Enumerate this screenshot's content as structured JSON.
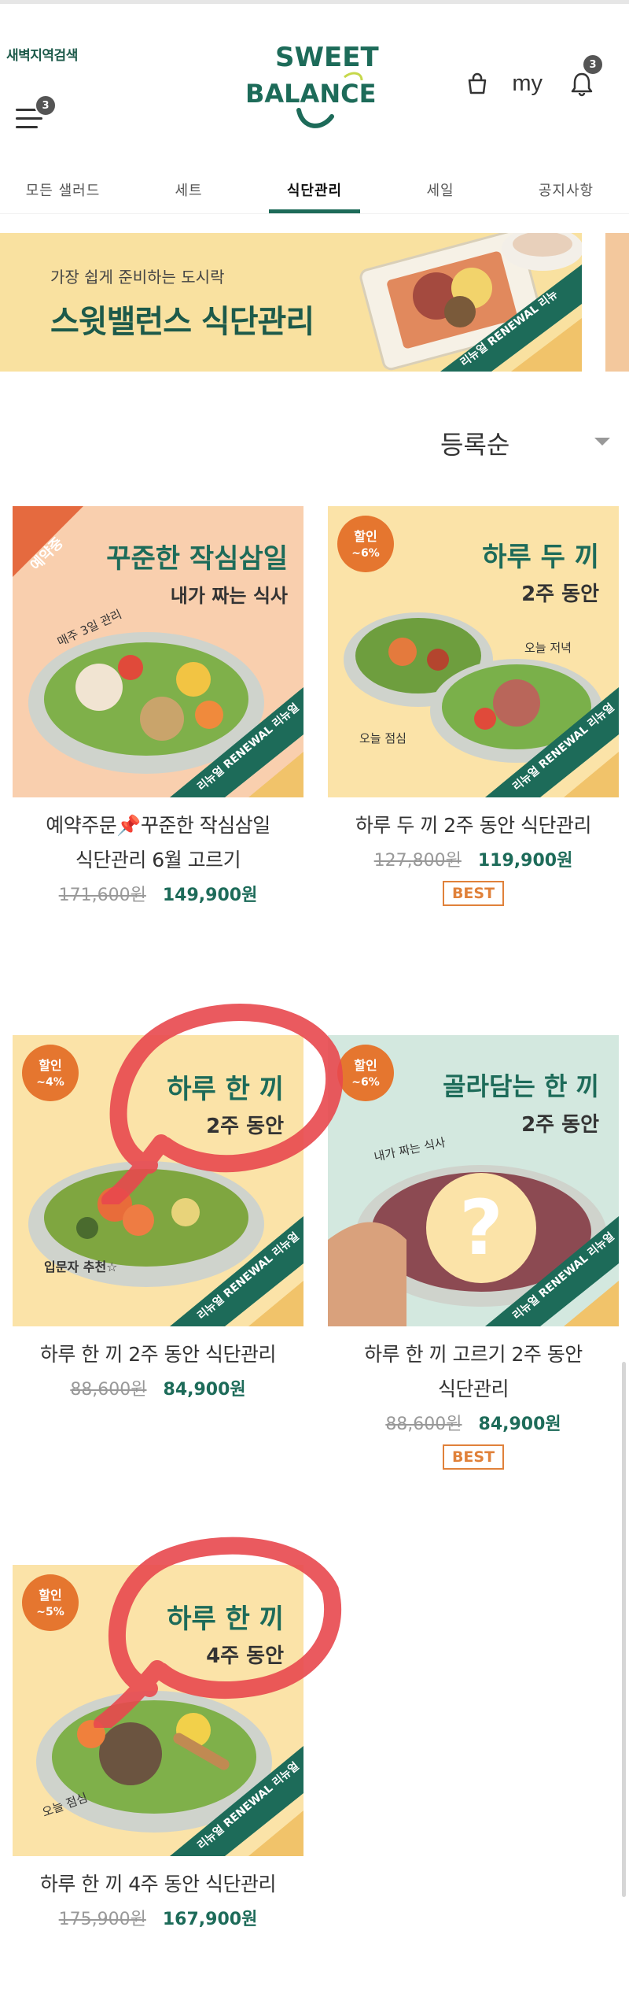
{
  "header": {
    "region_search": "새벽지역검색",
    "menu_badge": "3",
    "logo_top": "SWEET",
    "logo_bottom": "BALANCE",
    "my_label": "my",
    "notification_badge": "3"
  },
  "tabs": [
    {
      "label": "모든 샐러드",
      "active": false
    },
    {
      "label": "세트",
      "active": false
    },
    {
      "label": "식단관리",
      "active": true
    },
    {
      "label": "세일",
      "active": false
    },
    {
      "label": "공지사항",
      "active": false
    }
  ],
  "banner": {
    "subtitle": "가장 쉽게 준비하는 도시락",
    "title": "스윗밸런스 식단관리",
    "ribbon": "리뉴얼 RENEWAL 리뉴"
  },
  "sort": {
    "selected": "등록순"
  },
  "products": [
    {
      "tag": "예약중",
      "img_title": "꾸준한 작심삼일",
      "img_sub": "내가 짜는 식사",
      "img_note": "매주 3일 관리",
      "ribbon": "리뉴얼 RENEWAL 리뉴얼",
      "name_line1": "예약주문📌꾸준한 작심삼일",
      "name_line2": "식단관리 6월 고르기",
      "old_price": "171,600원",
      "new_price": "149,900원",
      "best": "",
      "bg": "#f9cfae"
    },
    {
      "tag": "할인 ~6%",
      "img_title": "하루 두 끼",
      "img_sub": "2주 동안",
      "img_note": "오늘 점심",
      "img_note2": "오늘 저녁",
      "ribbon": "리뉴얼 RENEWAL 리뉴얼",
      "name_line1": "하루 두 끼 2주 동안 식단관리",
      "name_line2": "",
      "old_price": "127,800원",
      "new_price": "119,900원",
      "best": "BEST",
      "bg": "#fbe3a8"
    },
    {
      "tag": "할인 ~4%",
      "img_title": "하루 한 끼",
      "img_sub": "2주 동안",
      "img_note": "입문자 추천☆",
      "ribbon": "리뉴얼 RENEWAL 리뉴얼",
      "name_line1": "하루 한 끼 2주 동안 식단관리",
      "name_line2": "",
      "old_price": "88,600원",
      "new_price": "84,900원",
      "best": "",
      "bg": "#fbe3a8"
    },
    {
      "tag": "할인 ~6%",
      "img_title": "골라담는 한 끼",
      "img_sub": "2주 동안",
      "img_note": "내가 짜는 식사",
      "ribbon": "리뉴얼 RENEWAL 리뉴얼",
      "name_line1": "하루 한 끼 고르기 2주 동안",
      "name_line2": "식단관리",
      "old_price": "88,600원",
      "new_price": "84,900원",
      "best": "BEST",
      "bg": "#d3e8df"
    },
    {
      "tag": "할인 ~5%",
      "img_title": "하루 한 끼",
      "img_sub": "4주 동안",
      "img_note": "오늘 점심",
      "ribbon": "리뉴얼 RENEWAL 리뉴얼",
      "name_line1": "하루 한 끼 4주 동안 식단관리",
      "name_line2": "",
      "old_price": "175,900원",
      "new_price": "167,900원",
      "best": "",
      "bg": "#fbe3a8"
    }
  ],
  "colors": {
    "brand_green": "#1d6b59",
    "accent_orange": "#e0813a",
    "annotation_red": "#e8484e"
  }
}
